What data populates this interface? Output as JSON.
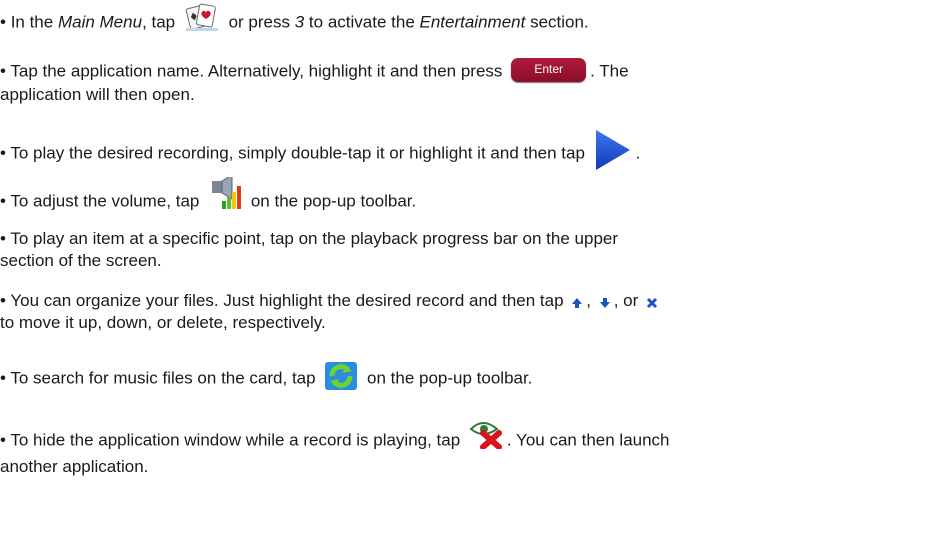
{
  "items": [
    {
      "bullet": "•",
      "t1": "In the ",
      "t2": "Main Menu",
      "t3": ", tap ",
      "t4": " or press ",
      "t5": "3",
      "t6": " to activate the ",
      "t7": "Entertainment",
      "t8": " section."
    },
    {
      "bullet": "•",
      "t1": "Tap the application name. Alternatively, highlight it and then press ",
      "key_label": "Enter",
      "t2": ". The",
      "t3": "application will then open."
    },
    {
      "bullet": "•",
      "t1": "To play the desired recording, simply double-tap it or highlight it and then tap ",
      "t2": "."
    },
    {
      "bullet": "•",
      "t1": "To adjust the volume, tap ",
      "t2": " on the pop-up toolbar."
    },
    {
      "bullet": "•",
      "t1": "To play an item at a specific point, tap on the playback progress bar on the upper",
      "t2": "section of the screen."
    },
    {
      "bullet": "•",
      "t1": "You can organize your files. Just highlight the desired record and then tap ",
      "t2": ", ",
      "t3": ", or ",
      "t4": "to move it up, down, or delete, respectively."
    },
    {
      "bullet": "•",
      "t1": "To search for music files on the card, tap ",
      "t2": " on the pop-up toolbar."
    },
    {
      "bullet": "•",
      "t1": "To hide the application window while a record is playing, tap ",
      "t2": ". You can then launch",
      "t3": "another application."
    }
  ],
  "icons": {
    "entertainment": "playing-cards-icon",
    "enter": "enter-key-icon",
    "play": "play-icon",
    "volume": "volume-icon",
    "up": "arrow-up-icon",
    "down": "arrow-down-icon",
    "delete": "delete-x-icon",
    "refresh": "refresh-icon",
    "hide": "hide-eye-icon"
  },
  "colors": {
    "accent_red": "#b01a3a",
    "play_blue": "#1f4fd1",
    "refresh_green": "#2e9c2e",
    "delete_blue": "#2050c8"
  }
}
